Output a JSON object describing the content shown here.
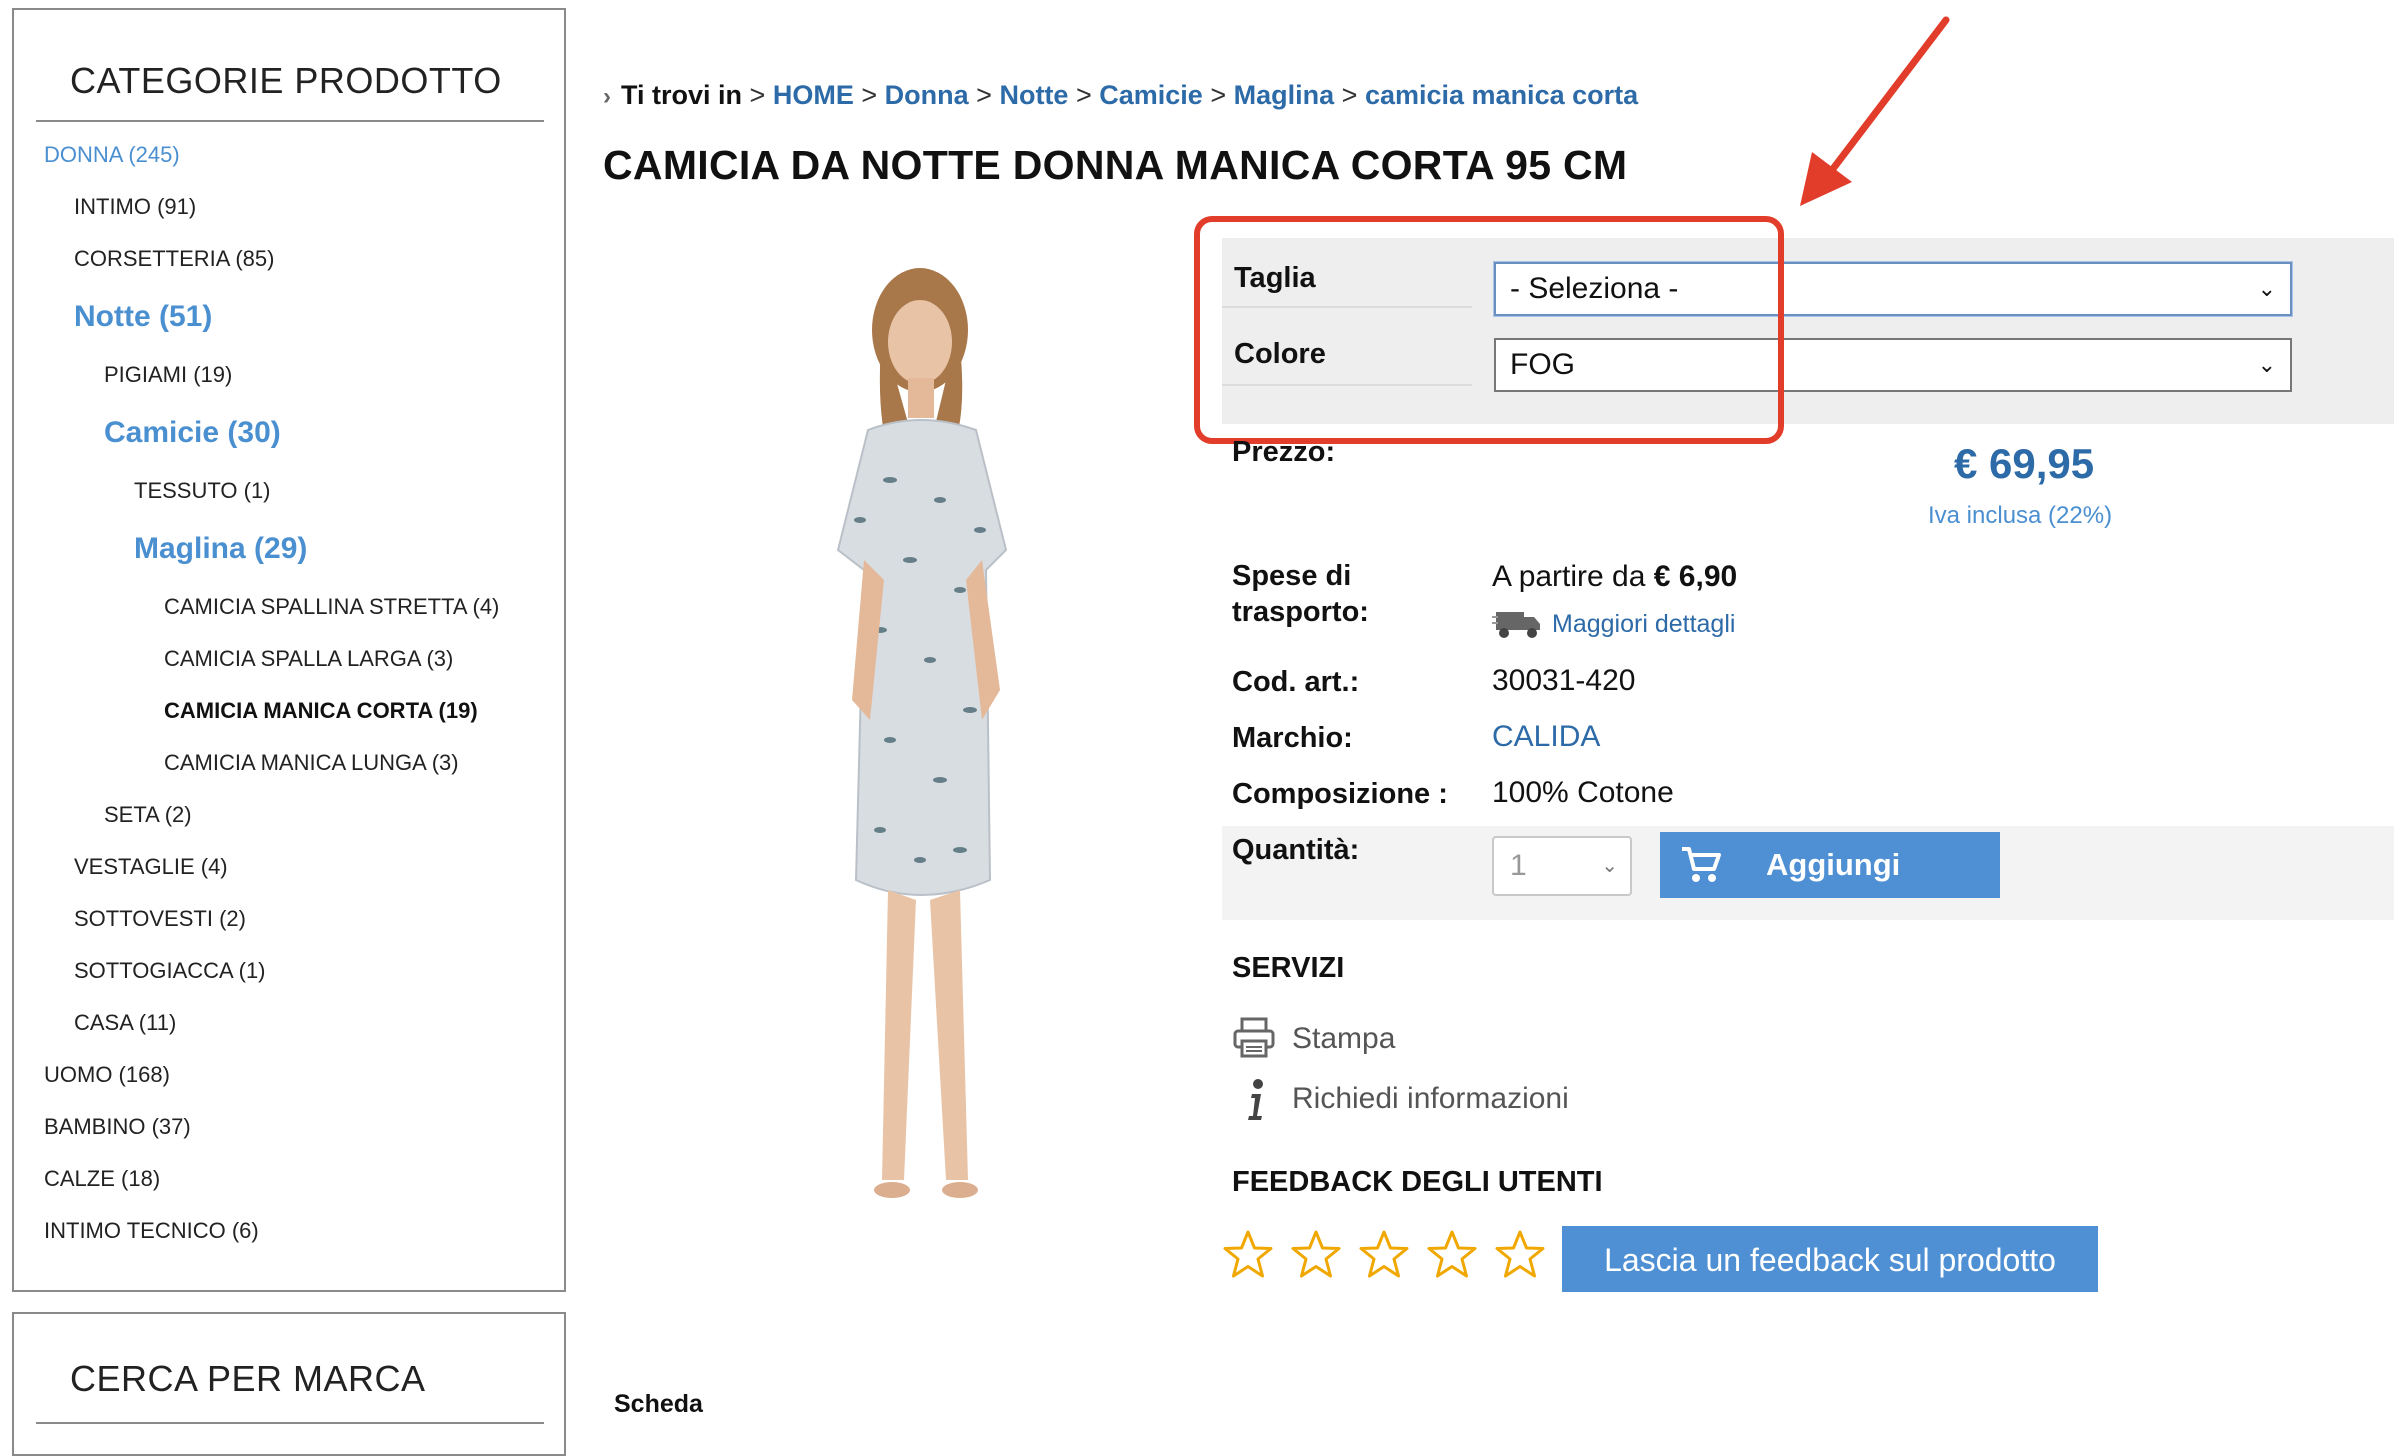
{
  "sidebar": {
    "categories_title": "CATEGORIE PRODOTTO",
    "items": [
      {
        "label": "DONNA (245)"
      },
      {
        "label": "INTIMO (91)"
      },
      {
        "label": "CORSETTERIA (85)"
      },
      {
        "label": "Notte (51)"
      },
      {
        "label": "PIGIAMI (19)"
      },
      {
        "label": "Camicie (30)"
      },
      {
        "label": "TESSUTO (1)"
      },
      {
        "label": "Maglina (29)"
      },
      {
        "label": "CAMICIA SPALLINA STRETTA (4)"
      },
      {
        "label": "CAMICIA SPALLA LARGA (3)"
      },
      {
        "label": "CAMICIA MANICA CORTA (19)"
      },
      {
        "label": "CAMICIA MANICA LUNGA (3)"
      },
      {
        "label": "SETA (2)"
      },
      {
        "label": "VESTAGLIE (4)"
      },
      {
        "label": "SOTTOVESTI (2)"
      },
      {
        "label": "SOTTOGIACCA (1)"
      },
      {
        "label": "CASA (11)"
      },
      {
        "label": "UOMO (168)"
      },
      {
        "label": "BAMBINO (37)"
      },
      {
        "label": "CALZE (18)"
      },
      {
        "label": "INTIMO TECNICO (6)"
      }
    ],
    "brand_title": "CERCA PER MARCA"
  },
  "breadcrumb": {
    "prefix": "Ti trovi in",
    "links": [
      "HOME",
      "Donna",
      "Notte",
      "Camicie",
      "Maglina",
      "camicia manica corta"
    ]
  },
  "product": {
    "title": "CAMICIA DA NOTTE DONNA MANICA CORTA 95 CM",
    "size_label": "Taglia",
    "size_value": "- Seleziona -",
    "color_label": "Colore",
    "color_value": "FOG",
    "price_label": "Prezzo:",
    "price": "€ 69,95",
    "vat": "Iva inclusa (22%)",
    "shipping_label_1": "Spese di",
    "shipping_label_2": "trasporto:",
    "shipping_prefix": "A partire da",
    "shipping_value": "€ 6,90",
    "shipping_details": "Maggiori dettagli",
    "code_label": "Cod. art.:",
    "code_value": "30031-420",
    "brand_label": "Marchio:",
    "brand_value": "CALIDA",
    "composition_label": "Composizione :",
    "composition_value": "100% Cotone",
    "qty_label": "Quantità:",
    "qty_value": "1",
    "add_label": "Aggiungi"
  },
  "services": {
    "title": "SERVIZI",
    "print": "Stampa",
    "info": "Richiedi informazioni"
  },
  "feedback": {
    "title": "FEEDBACK DEGLI UTENTI",
    "rating": 0,
    "max_rating": 5,
    "button": "Lascia un feedback sul prodotto"
  },
  "tabs": {
    "scheda": "Scheda"
  },
  "colors": {
    "link": "#2d6aa8",
    "accent": "#4e90d3",
    "annotation": "#e23c2a",
    "star": "#f0a800"
  }
}
